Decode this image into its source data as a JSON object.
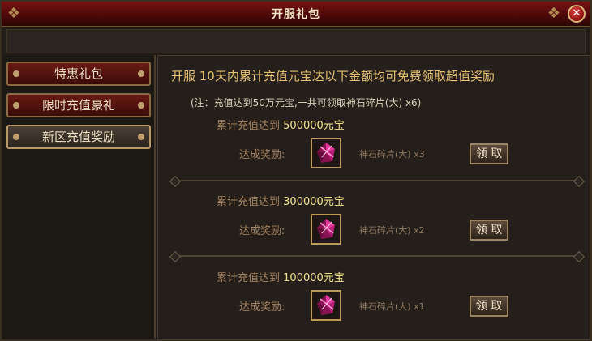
{
  "window": {
    "title": "开服礼包",
    "close_label": "✕"
  },
  "sidebar": {
    "tabs": [
      {
        "label": "特惠礼包",
        "active": false
      },
      {
        "label": "限时充值豪礼",
        "active": false
      },
      {
        "label": "新区充值奖励",
        "active": true
      }
    ]
  },
  "main": {
    "heading": "开服  10天内累计充值元宝达以下金额均可免费领取超值奖励",
    "note": "(注：充值达到50万元宝,一共可领取神石碎片(大) x6)",
    "tiers": [
      {
        "req_label": "累计充值达到",
        "amount": "500000元宝",
        "reward_label": "达成奖励:",
        "item_name": "神石碎片(大) x3",
        "claim_label": "领 取"
      },
      {
        "req_label": "累计充值达到",
        "amount": "300000元宝",
        "reward_label": "达成奖励:",
        "item_name": "神石碎片(大) x2",
        "claim_label": "领 取"
      },
      {
        "req_label": "累计充值达到",
        "amount": "100000元宝",
        "reward_label": "达成奖励:",
        "item_name": "神石碎片(大) x1",
        "claim_label": "领 取"
      }
    ]
  },
  "icons": {
    "item": "god-stone-fragment-icon",
    "close": "close-icon"
  },
  "colors": {
    "title_bar": "#7a1212",
    "accent_gold": "#e6c070",
    "amount": "#f0e090"
  }
}
